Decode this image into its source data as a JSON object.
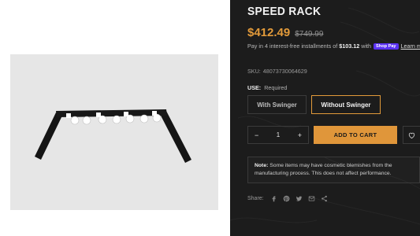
{
  "product": {
    "title": "SPEED RACK",
    "price": "$412.49",
    "compare_price": "$749.99"
  },
  "installments": {
    "prefix": "Pay in 4 interest-free installments of",
    "amount": "$103.12",
    "with": "with",
    "badge": "Shop Pay",
    "link": "Learn more"
  },
  "sku": {
    "label": "SKU:",
    "value": "48073730064629"
  },
  "use": {
    "label": "USE:",
    "value": "Required"
  },
  "options": [
    {
      "label": "With Swinger",
      "selected": false
    },
    {
      "label": "Without Swinger",
      "selected": true
    }
  ],
  "quantity": {
    "minus": "−",
    "value": "1",
    "plus": "+"
  },
  "cart": {
    "label": "ADD TO CART"
  },
  "note": {
    "label": "Note:",
    "text": "Some items may have cosmetic blemishes from the manufacturing process. This does not affect performance."
  },
  "share": {
    "label": "Share:",
    "icons": [
      "facebook-icon",
      "pinterest-icon",
      "twitter-icon",
      "email-icon",
      "share-icon"
    ]
  },
  "colors": {
    "panel_bg": "#1c1c1c",
    "accent": "#e0963a",
    "price": "#e29a3a",
    "shop_pay": "#5a31f4"
  }
}
